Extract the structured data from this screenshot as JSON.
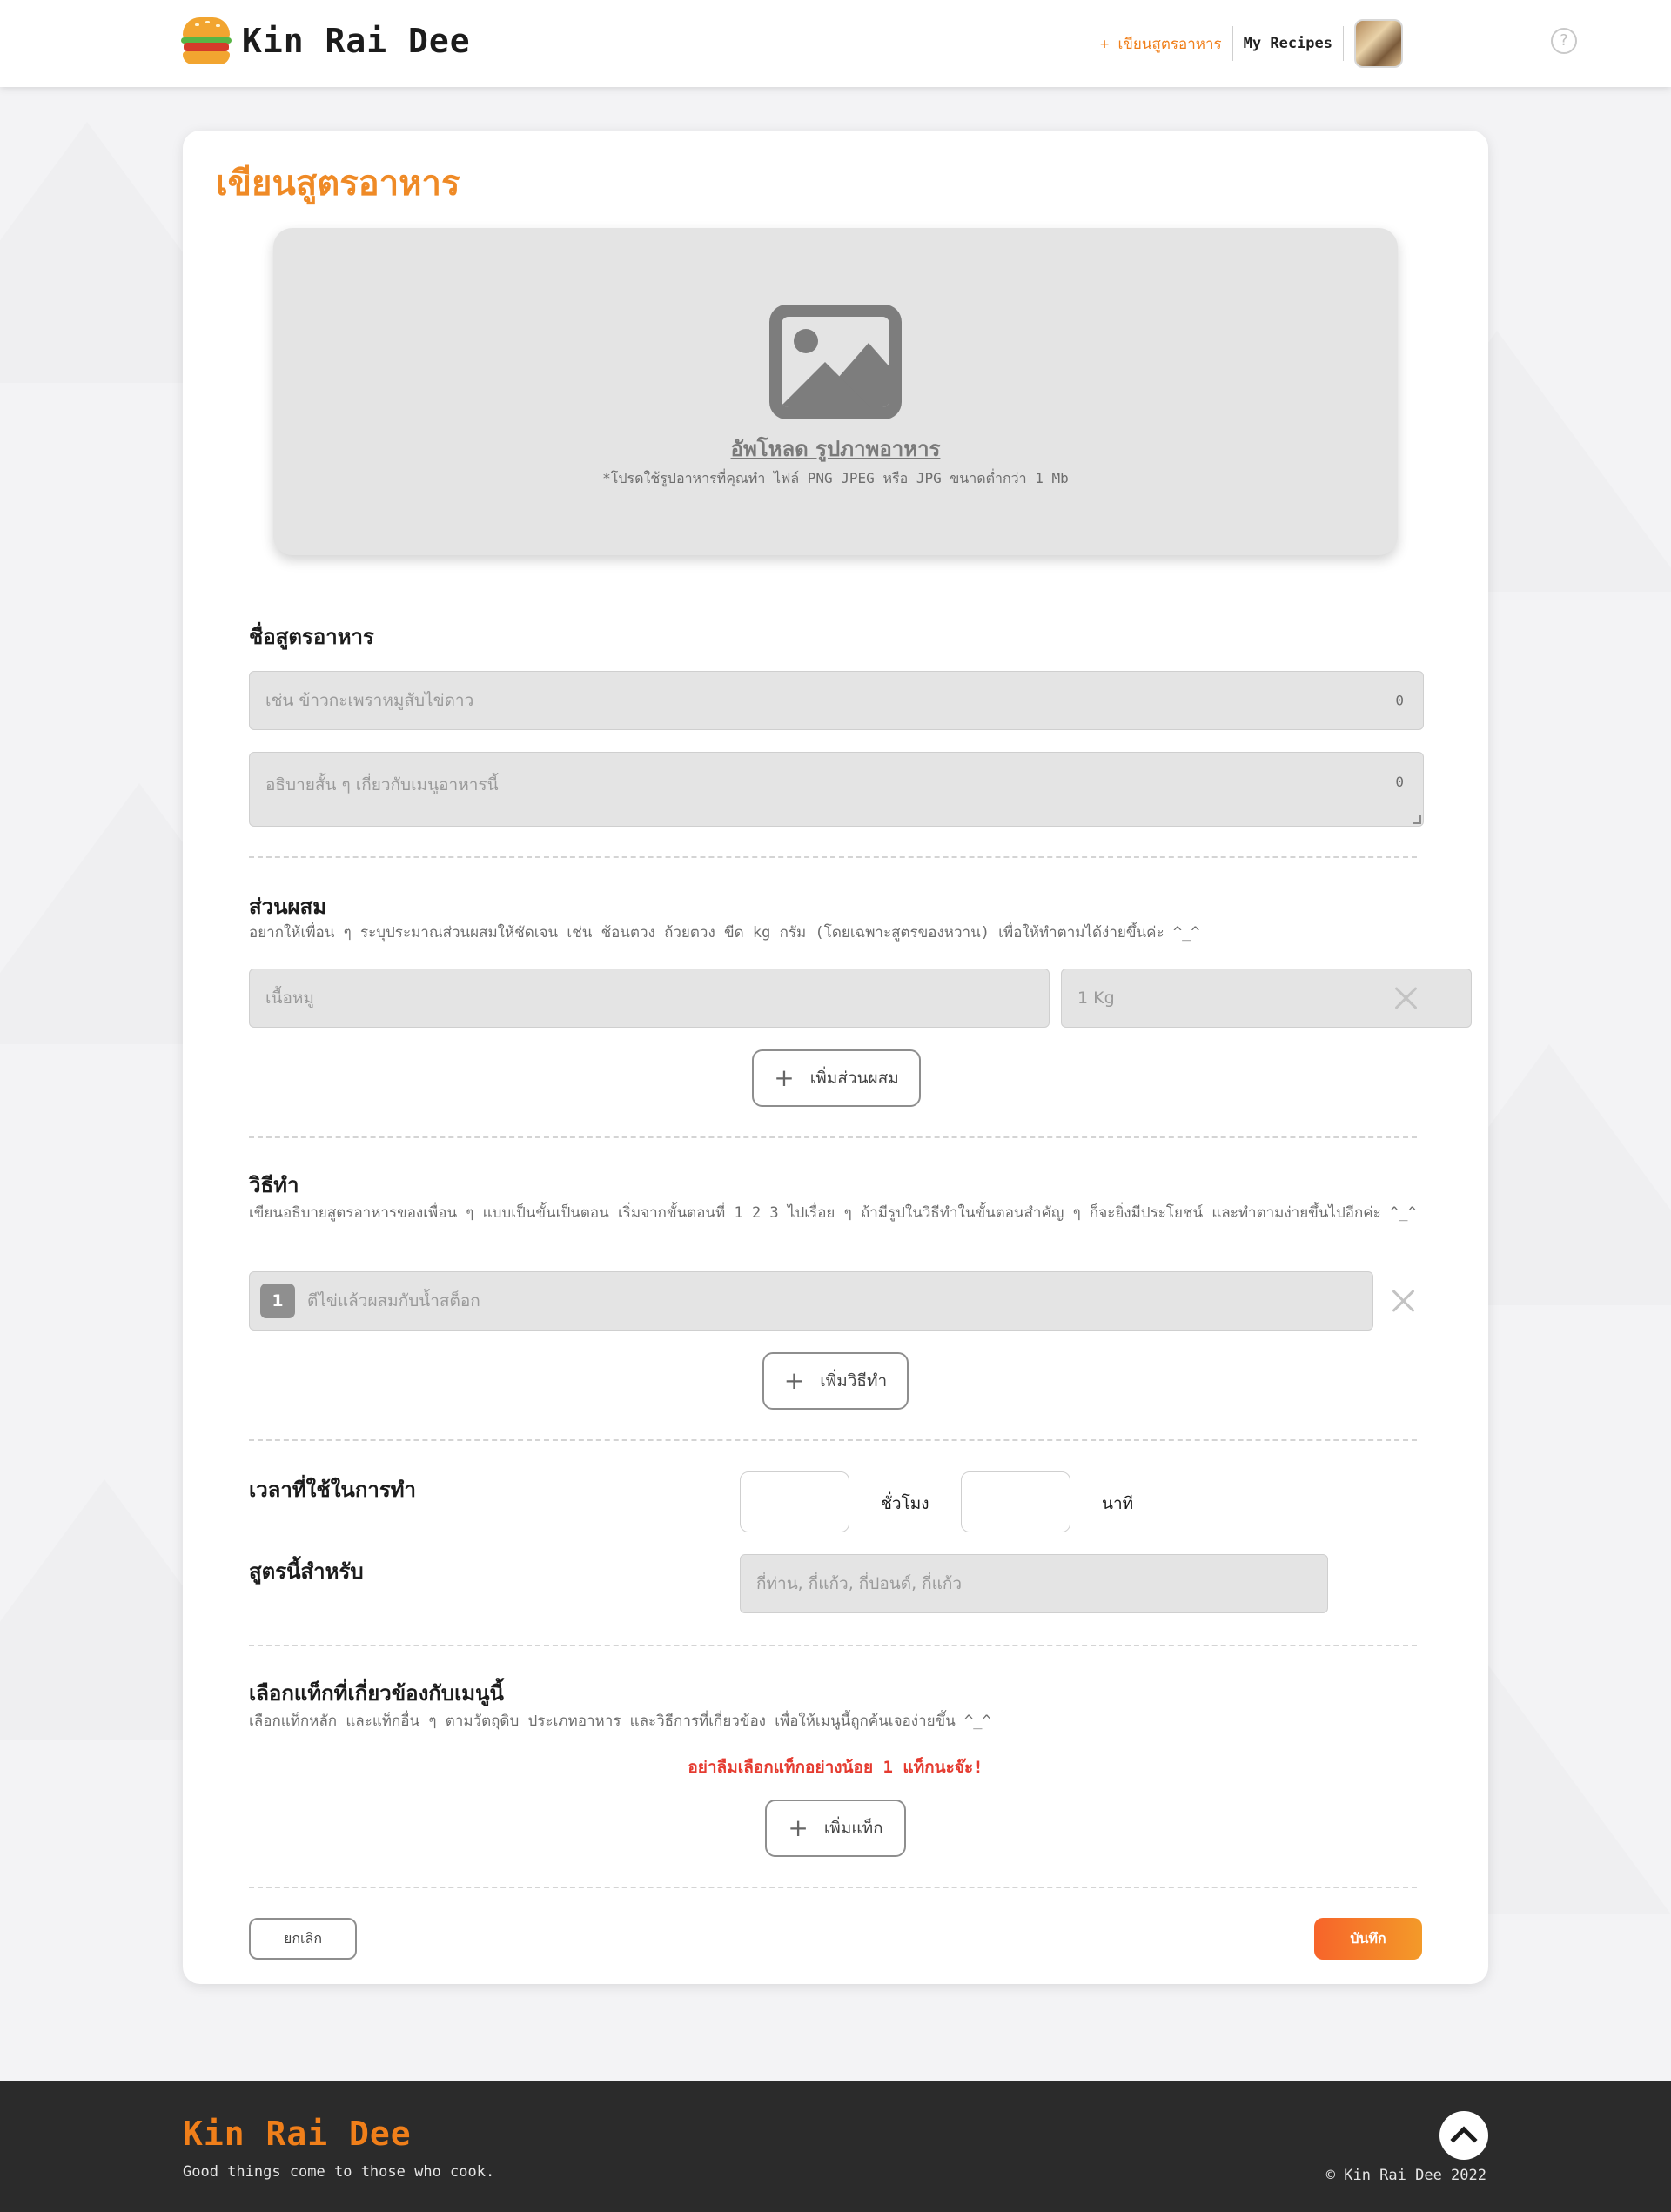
{
  "header": {
    "brand": "Kin Rai Dee",
    "nav_write": "+ เขียนสูตรอาหาร",
    "nav_recipes": "My Recipes",
    "help_glyph": "?"
  },
  "page": {
    "title": "เขียนสูตรอาหาร"
  },
  "upload": {
    "title": "อัพโหลด รูปภาพอาหาร",
    "hint": "*โปรดใช้รูปอาหารที่คุณทำ ไฟล์ PNG JPEG หรือ JPG ขนาดต่ำกว่า 1 Mb"
  },
  "recipe_name": {
    "label": "ชื่อสูตรอาหาร",
    "name_placeholder": "เช่น ข้าวกะเพราหมูสับไข่ดาว",
    "name_count": "0",
    "desc_placeholder": "อธิบายสั้น ๆ เกี่ยวกับเมนูอาหารนี้",
    "desc_count": "0"
  },
  "ingredients": {
    "label": "ส่วนผสม",
    "hint": "อยากให้เพื่อน ๆ ระบุประมาณส่วนผสมให้ชัดเจน เช่น ช้อนตวง ถ้วยตวง ขีด kg กรัม (โดยเฉพาะสูตรของหวาน) เพื่อให้ทำตามได้ง่ายขึ้นค่ะ ^_^",
    "item_placeholder": "เนื้อหมู",
    "amount_placeholder": "1 Kg",
    "add_label": "เพิ่มส่วนผสม"
  },
  "steps": {
    "label": "วิธีทำ",
    "hint": "เขียนอธิบายสูตรอาหารของเพื่อน ๆ แบบเป็นขั้นเป็นตอน เริ่มจากขั้นตอนที่ 1 2 3 ไปเรื่อย ๆ ถ้ามีรูปในวิธีทำในขั้นตอนสำคัญ ๆ ก็จะยิ่งมีประโยชน์ และทำตามง่ายขึ้นไปอีกค่ะ ^_^",
    "step_number": "1",
    "step_placeholder": "ตีไข่แล้วผสมกับน้ำสต็อก",
    "add_label": "เพิ่มวิธีทำ"
  },
  "time": {
    "label": "เวลาที่ใช้ในการทำ",
    "hours_unit": "ชั่วโมง",
    "minutes_unit": "นาที"
  },
  "serving": {
    "label": "สูตรนี้สำหรับ",
    "placeholder": "กี่ท่าน, กี่แก้ว, กี่ปอนด์, กี่แก้ว"
  },
  "tags": {
    "label": "เลือกแท็กที่เกี่ยวข้องกับเมนูนี้",
    "hint": "เลือกแท็กหลัก และแท็กอื่น ๆ ตามวัตถุดิบ ประเภทอาหาร และวิธีการที่เกี่ยวข้อง เพื่อให้เมนูนี้ถูกค้นเจอง่ายขึ้น ^_^",
    "warning": "อย่าลืมเลือกแท็กอย่างน้อย 1 แท็กนะจ๊ะ!",
    "add_label": "เพิ่มแท็ก"
  },
  "actions": {
    "cancel": "ยกเลิก",
    "save": "บันทึก"
  },
  "footer": {
    "brand": "Kin Rai Dee",
    "tagline": "Good things come to those who cook.",
    "copyright": "© Kin Rai Dee 2022"
  },
  "colors": {
    "accent": "#ef8a26",
    "warning": "#e53b30",
    "save_gradient_start": "#f7642a",
    "save_gradient_end": "#f39a29"
  }
}
